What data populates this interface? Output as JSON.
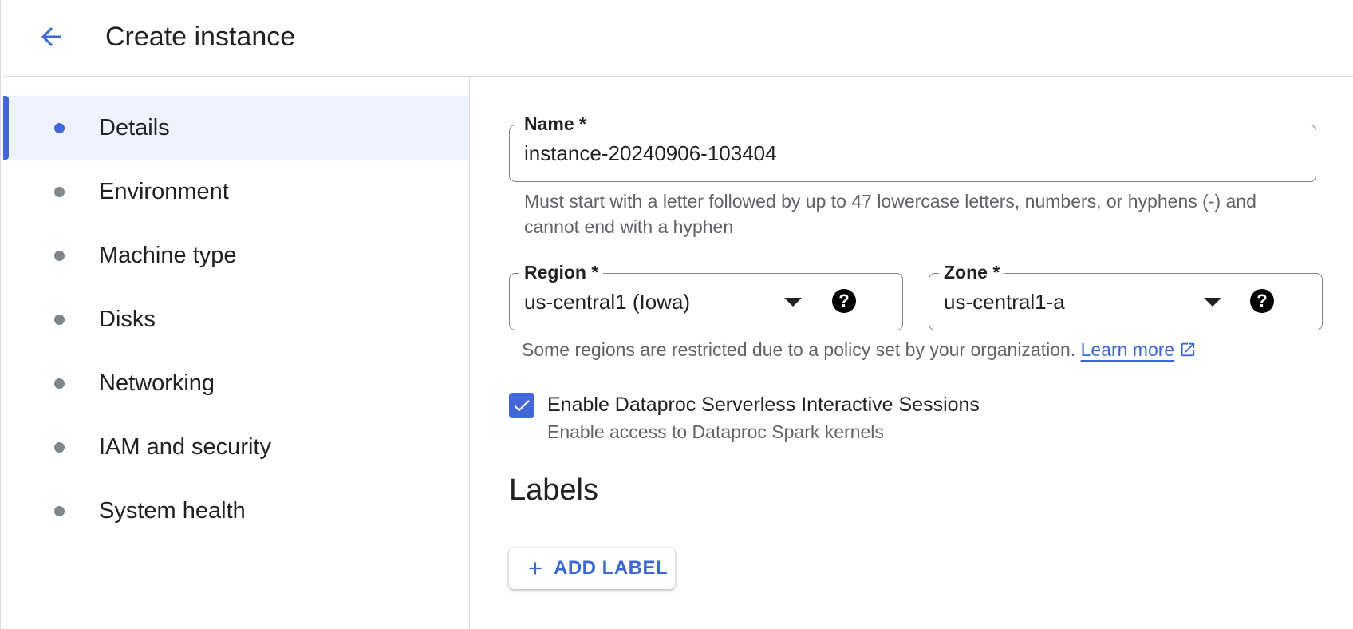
{
  "header": {
    "title": "Create instance",
    "back_icon": "arrow-back-icon"
  },
  "sidebar": {
    "items": [
      {
        "label": "Details",
        "active": true
      },
      {
        "label": "Environment",
        "active": false
      },
      {
        "label": "Machine type",
        "active": false
      },
      {
        "label": "Disks",
        "active": false
      },
      {
        "label": "Networking",
        "active": false
      },
      {
        "label": "IAM and security",
        "active": false
      },
      {
        "label": "System health",
        "active": false
      }
    ]
  },
  "form": {
    "name": {
      "label": "Name *",
      "value": "instance-20240906-103404",
      "hint": "Must start with a letter followed by up to 47 lowercase letters, numbers, or hyphens (-) and cannot end with a hyphen"
    },
    "region": {
      "label": "Region *",
      "value": "us-central1 (Iowa)"
    },
    "zone": {
      "label": "Zone *",
      "value": "us-central1-a"
    },
    "region_hint": "Some regions are restricted due to a policy set by your organization.",
    "learn_more": "Learn more",
    "serverless": {
      "checked": true,
      "label": "Enable Dataproc Serverless Interactive Sessions",
      "sublabel": "Enable access to Dataproc Spark kernels"
    },
    "labels_section": {
      "title": "Labels",
      "add_button": "ADD LABEL"
    }
  },
  "colors": {
    "accent": "#4267d6",
    "link": "#3c68d4",
    "active_bg": "#eef3fd",
    "border": "#dadce0",
    "hint_text": "#5f6368"
  }
}
